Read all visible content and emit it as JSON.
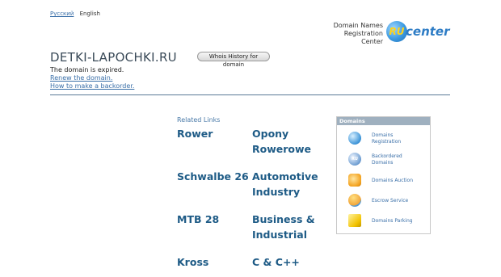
{
  "lang": {
    "ru": "Русский",
    "en": "English"
  },
  "registrar": {
    "text_line1": "Domain Names",
    "text_line2": "Registration",
    "text_line3": "Center",
    "logo_ball": "RU",
    "logo_word": "center",
    "accent": "#2d7cc5"
  },
  "domain": {
    "name": "DETKI-LAPOCHKI.RU",
    "whois_button": "Whois History for domain"
  },
  "status": {
    "expired": "The domain is expired.",
    "renew_link": "Renew the domain.",
    "backorder_link": "How to make a backorder."
  },
  "related": {
    "title": "Related Links",
    "links": [
      "Rower",
      "Opony Rowerowe",
      "Schwalbe 26",
      "Automotive Industry",
      "MTB 28",
      "Business & Industrial",
      "Kross",
      "C & C++"
    ]
  },
  "services": {
    "header": "Domains",
    "items": [
      {
        "label": "Domains Registration",
        "icon": "globe-icon"
      },
      {
        "label": "Backordered Domains",
        "icon": "ru-badge-icon"
      },
      {
        "label": "Domains Auction",
        "icon": "hammer-icon"
      },
      {
        "label": "Escrow Service",
        "icon": "escrow-icon"
      },
      {
        "label": "Domains Parking",
        "icon": "parking-icon"
      }
    ]
  }
}
